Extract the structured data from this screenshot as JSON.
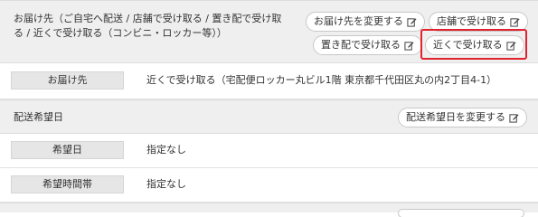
{
  "delivery_section": {
    "title": "お届け先（ご自宅へ配送 / 店舗で受け取る / 置き配で受け取る / 近くで受け取る（コンビニ・ロッカー等））",
    "buttons": {
      "change_address": "お届け先を変更する",
      "store_pickup": "店舗で受け取る",
      "drop_off": "置き配で受け取る",
      "nearby_pickup": "近くで受け取る"
    }
  },
  "address_row": {
    "label": "お届け先",
    "value": "近くで受け取る（宅配便ロッカー丸ビル1階 東京都千代田区丸の内2丁目4-1）"
  },
  "schedule_section": {
    "title": "配送希望日",
    "button": "配送希望日を変更する"
  },
  "date_row": {
    "label": "希望日",
    "value": "指定なし"
  },
  "time_row": {
    "label": "希望時間帯",
    "value": "指定なし"
  },
  "colors": {
    "highlight": "#e0232e",
    "header_bg": "#efefef",
    "label_bg": "#e6e6e6"
  }
}
